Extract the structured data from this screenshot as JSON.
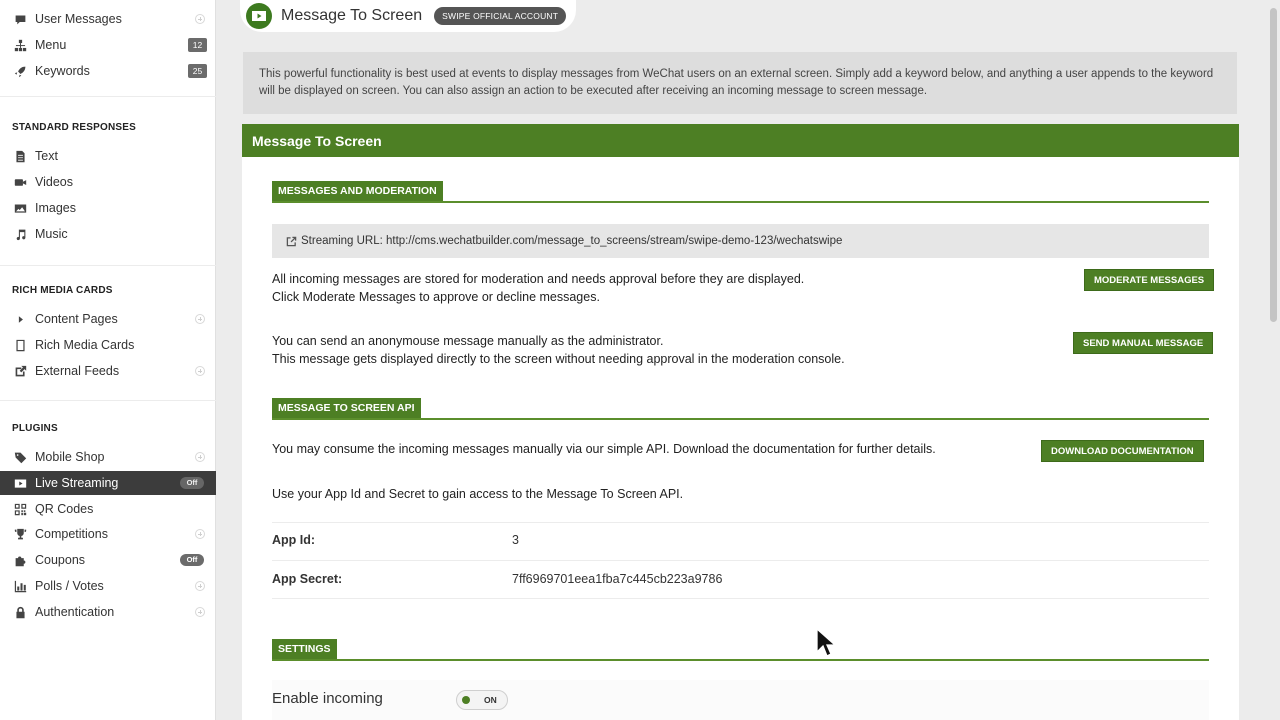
{
  "sidebar": {
    "items_top": [
      {
        "label": "User Messages",
        "icon": "comment-icon",
        "extra": "plus"
      },
      {
        "label": "Menu",
        "icon": "sitemap-icon",
        "extra": "badge",
        "badge": "12"
      },
      {
        "label": "Keywords",
        "icon": "rocket-icon",
        "extra": "badge",
        "badge": "25"
      }
    ],
    "standard_responses": {
      "heading": "STANDARD RESPONSES",
      "items": [
        {
          "label": "Text",
          "icon": "document-icon"
        },
        {
          "label": "Videos",
          "icon": "video-camera-icon"
        },
        {
          "label": "Images",
          "icon": "picture-icon"
        },
        {
          "label": "Music",
          "icon": "music-note-icon"
        }
      ]
    },
    "rich_media_cards": {
      "heading": "RICH MEDIA CARDS",
      "items": [
        {
          "label": "Content Pages",
          "icon": "caret-right-icon",
          "extra": "plus"
        },
        {
          "label": "Rich Media Cards",
          "icon": "card-icon"
        },
        {
          "label": "External Feeds",
          "icon": "external-link-icon",
          "extra": "plus"
        }
      ]
    },
    "plugins": {
      "heading": "PLUGINS",
      "items": [
        {
          "label": "Mobile Shop",
          "icon": "tag-icon",
          "extra": "plus"
        },
        {
          "label": "Live Streaming",
          "icon": "play-icon",
          "extra": "off",
          "off": "Off",
          "active": true
        },
        {
          "label": "QR Codes",
          "icon": "qr-code-icon"
        },
        {
          "label": "Competitions",
          "icon": "trophy-icon",
          "extra": "plus"
        },
        {
          "label": "Coupons",
          "icon": "puzzle-icon",
          "extra": "off",
          "off": "Off"
        },
        {
          "label": "Polls / Votes",
          "icon": "bar-chart-icon",
          "extra": "plus"
        },
        {
          "label": "Authentication",
          "icon": "lock-icon",
          "extra": "plus"
        }
      ]
    }
  },
  "header": {
    "title": "Message To Screen",
    "account_badge": "SWIPE OFFICIAL ACCOUNT"
  },
  "info": {
    "text": "This powerful functionality is best used at events to display messages from WeChat users on an external screen. Simply add a keyword below, and anything a user appends to the keyword will be displayed on screen. You can also assign an action to be executed after receiving an incoming message to screen message."
  },
  "panel": {
    "title": "Message To Screen",
    "moderation": {
      "heading": "MESSAGES AND MODERATION",
      "streaming_url": "Streaming URL: http://cms.wechatbuilder.com/message_to_screens/stream/swipe-demo-123/wechatswipe",
      "moderate_line1": "All incoming messages are stored for moderation and needs approval before they are displayed.",
      "moderate_line2": "Click Moderate Messages to approve or decline messages.",
      "moderate_button": "MODERATE MESSAGES",
      "manual_line1": "You can send an anonymouse message manually as the administrator.",
      "manual_line2": "This message gets displayed directly to the screen without needing approval in the moderation console.",
      "manual_button": "SEND MANUAL MESSAGE"
    },
    "api": {
      "heading": "MESSAGE TO SCREEN API",
      "consume_text": "You may consume the incoming messages manually via our simple API. Download the documentation for further details.",
      "download_button": "DOWNLOAD DOCUMENTATION",
      "access_text": "Use your App Id and Secret to gain access to the Message To Screen API.",
      "app_id_label": "App Id:",
      "app_id_value": "3",
      "app_secret_label": "App Secret:",
      "app_secret_value": "7ff6969701eea1fba7c445cb223a9786"
    },
    "settings": {
      "heading": "SETTINGS",
      "enable_incoming_label": "Enable incoming",
      "toggle_state": "ON"
    }
  },
  "colors": {
    "brand_green": "#4d7f24",
    "sidebar_active": "#3c3c3c"
  }
}
